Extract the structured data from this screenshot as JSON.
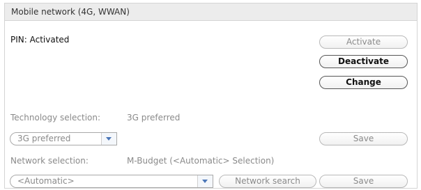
{
  "panel": {
    "title": "Mobile network (4G, WWAN)"
  },
  "pin": {
    "status_label": "PIN: Activated",
    "buttons": {
      "activate": "Activate",
      "deactivate": "Deactivate",
      "change": "Change"
    }
  },
  "technology": {
    "label": "Technology selection:",
    "current_value": "3G preferred",
    "select_value": "3G preferred",
    "save_label": "Save"
  },
  "network": {
    "label": "Network selection:",
    "current_value": "M-Budget (<Automatic> Selection)",
    "select_value": "<Automatic>",
    "search_label": "Network search",
    "save_label": "Save"
  },
  "icons": {
    "dropdown": "chevron-down-icon"
  },
  "colors": {
    "header_bg": "#ececec",
    "disabled_text": "#8a8a8a",
    "arrow": "#4a76b8"
  }
}
